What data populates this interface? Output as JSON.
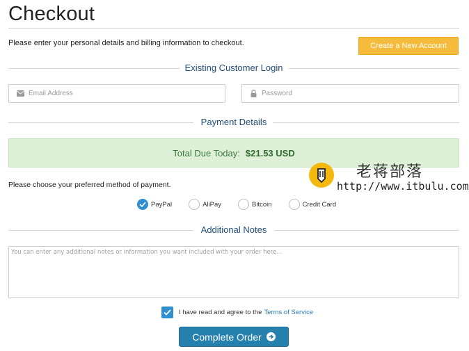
{
  "page": {
    "title": "Checkout",
    "intro": "Please enter your personal details and billing information to checkout.",
    "create_account_label": "Create a New Account"
  },
  "login": {
    "heading": "Existing Customer Login",
    "email_placeholder": "Email Address",
    "password_placeholder": "Password",
    "email_icon": "envelope-icon",
    "password_icon": "lock-icon"
  },
  "payment": {
    "heading": "Payment Details",
    "total_label": "Total Due Today:",
    "total_amount": "$21.53 USD",
    "choose_text": "Please choose your preferred method of payment.",
    "methods": [
      {
        "label": "PayPal",
        "selected": true
      },
      {
        "label": "AliPay",
        "selected": false
      },
      {
        "label": "Bitcoin",
        "selected": false
      },
      {
        "label": "Credit Card",
        "selected": false
      }
    ]
  },
  "notes": {
    "heading": "Additional Notes",
    "placeholder": "You can enter any additional notes or information you want included with your order here..."
  },
  "agreement": {
    "checked": true,
    "text": "I have read and agree to the",
    "link_text": "Terms of Service"
  },
  "submit": {
    "label": "Complete Order"
  },
  "watermark": {
    "title": "老蒋部落",
    "url": "http://www.itbulu.com"
  },
  "colors": {
    "accent": "#2580ad",
    "create_button": "#f7bb3c",
    "total_box": "#dff0d8",
    "heading": "#1f4e79"
  }
}
